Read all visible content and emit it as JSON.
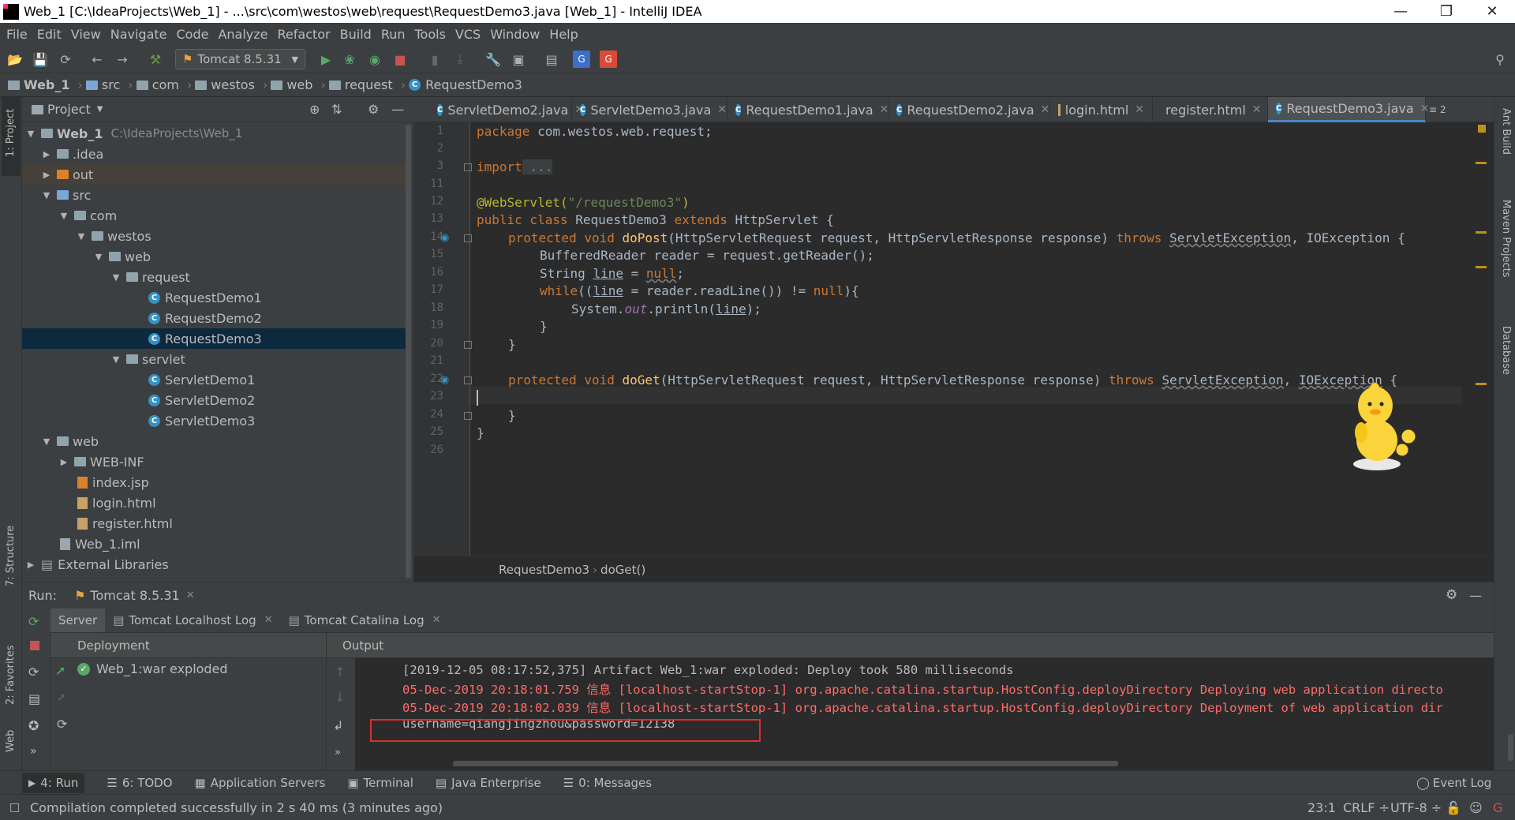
{
  "window": {
    "title": "Web_1 [C:\\IdeaProjects\\Web_1] - ...\\src\\com\\westos\\web\\request\\RequestDemo3.java [Web_1] - IntelliJ IDEA",
    "app_icon": "IJ"
  },
  "menu": [
    "File",
    "Edit",
    "View",
    "Navigate",
    "Code",
    "Analyze",
    "Refactor",
    "Build",
    "Run",
    "Tools",
    "VCS",
    "Window",
    "Help"
  ],
  "toolbar": {
    "run_config": "Tomcat 8.5.31"
  },
  "breadcrumbs": [
    "Web_1",
    "src",
    "com",
    "westos",
    "web",
    "request",
    "RequestDemo3"
  ],
  "left_strip": {
    "project": "1: Project",
    "structure": "7: Structure",
    "favorites": "2: Favorites",
    "web": "Web"
  },
  "right_strip": {
    "ant": "Ant Build",
    "maven": "Maven Projects",
    "database": "Database"
  },
  "project": {
    "header": "Project",
    "root_name": "Web_1",
    "root_path": "C:\\IdeaProjects\\Web_1",
    "items": {
      "idea": ".idea",
      "out": "out",
      "src": "src",
      "com": "com",
      "westos": "westos",
      "web": "web",
      "request": "request",
      "rd1": "RequestDemo1",
      "rd2": "RequestDemo2",
      "rd3": "RequestDemo3",
      "servlet": "servlet",
      "sd1": "ServletDemo1",
      "sd2": "ServletDemo2",
      "sd3": "ServletDemo3",
      "webdir": "web",
      "webinf": "WEB-INF",
      "index": "index.jsp",
      "login": "login.html",
      "register": "register.html",
      "iml": "Web_1.iml",
      "ext": "External Libraries"
    }
  },
  "tabs": [
    "ServletDemo2.java",
    "ServletDemo3.java",
    "RequestDemo1.java",
    "RequestDemo2.java",
    "login.html",
    "register.html",
    "RequestDemo3.java"
  ],
  "tab_overflow": "≡ 2",
  "line_numbers": [
    "1",
    "2",
    "3",
    "11",
    "12",
    "13",
    "14",
    "15",
    "16",
    "17",
    "18",
    "19",
    "20",
    "21",
    "22",
    "23",
    "24",
    "25",
    "26"
  ],
  "code": {
    "l1_kw": "package",
    "l1_rest": " com.westos.web.request;",
    "l3_kw": "import",
    "l3_rest": " ...",
    "l12_an": "@WebServlet(",
    "l12_st": "\"/requestDemo3\"",
    "l12_end": ")",
    "l13_kw": "public class",
    "l13_cls": " RequestDemo3 ",
    "l13_kw2": "extends",
    "l13_rest": " HttpServlet {",
    "l14_kw": "protected void",
    "l14_fn": "doPost",
    "l14_args": "(HttpServletRequest request, HttpServletResponse response) ",
    "l14_throws": "throws",
    "l14_ex1": "ServletException",
    "l14_end": ", IOException {",
    "l15": "BufferedReader reader = request.getReader();",
    "l16_a": "String ",
    "l16_var": "line",
    "l16_b": " = ",
    "l16_null": "null",
    "l16_c": ";",
    "l17_kw": "while",
    "l17_a": "((",
    "l17_var": "line",
    "l17_b": " = reader.readLine()) != ",
    "l17_null": "null",
    "l17_c": "){",
    "l18_a": "System.",
    "l18_out": "out",
    "l18_b": ".println(",
    "l18_var": "line",
    "l18_c": ");",
    "l19": "}",
    "l20": "}",
    "l22_kw": "protected void",
    "l22_fn": "doGet",
    "l22_args": "(HttpServletRequest request, HttpServletResponse response) ",
    "l22_throws": "throws",
    "l22_ex1": "ServletException",
    "l22_sep": ", ",
    "l22_ex2": "IOException",
    "l22_end": " {",
    "l24": "}",
    "l25": "}"
  },
  "editor_breadcrumb": {
    "class": "RequestDemo3",
    "method": "doGet()"
  },
  "run": {
    "label": "Run:",
    "config": "Tomcat 8.5.31",
    "tabs": [
      "Server",
      "Tomcat Localhost Log",
      "Tomcat Catalina Log"
    ],
    "deployment_header": "Deployment",
    "output_header": "Output",
    "artifact": "Web_1:war exploded",
    "output": [
      "[2019-12-05 08:17:52,375] Artifact Web_1:war exploded: Deploy took 580 milliseconds",
      "05-Dec-2019 20:18:01.759 信息 [localhost-startStop-1] org.apache.catalina.startup.HostConfig.deployDirectory Deploying web application directo",
      "05-Dec-2019 20:18:02.039 信息 [localhost-startStop-1] org.apache.catalina.startup.HostConfig.deployDirectory Deployment of web application dir",
      "username=qiangjingzhou&password=12138"
    ]
  },
  "bottom_tabs": [
    "4: Run",
    "6: TODO",
    "Application Servers",
    "Terminal",
    "Java Enterprise",
    "0: Messages"
  ],
  "event_log": "Event Log",
  "status": {
    "message": "Compilation completed successfully in 2 s 40 ms (3 minutes ago)",
    "position": "23:1",
    "line_sep": "CRLF ÷",
    "encoding": "UTF-8 ÷"
  },
  "colors": {
    "accent": "#4a88c7",
    "keyword": "#cc7832",
    "string": "#6a8759",
    "annotation": "#bbb529",
    "method": "#ffc66d",
    "error_text": "#ff6b68",
    "highlight_box": "#e02d2d"
  }
}
